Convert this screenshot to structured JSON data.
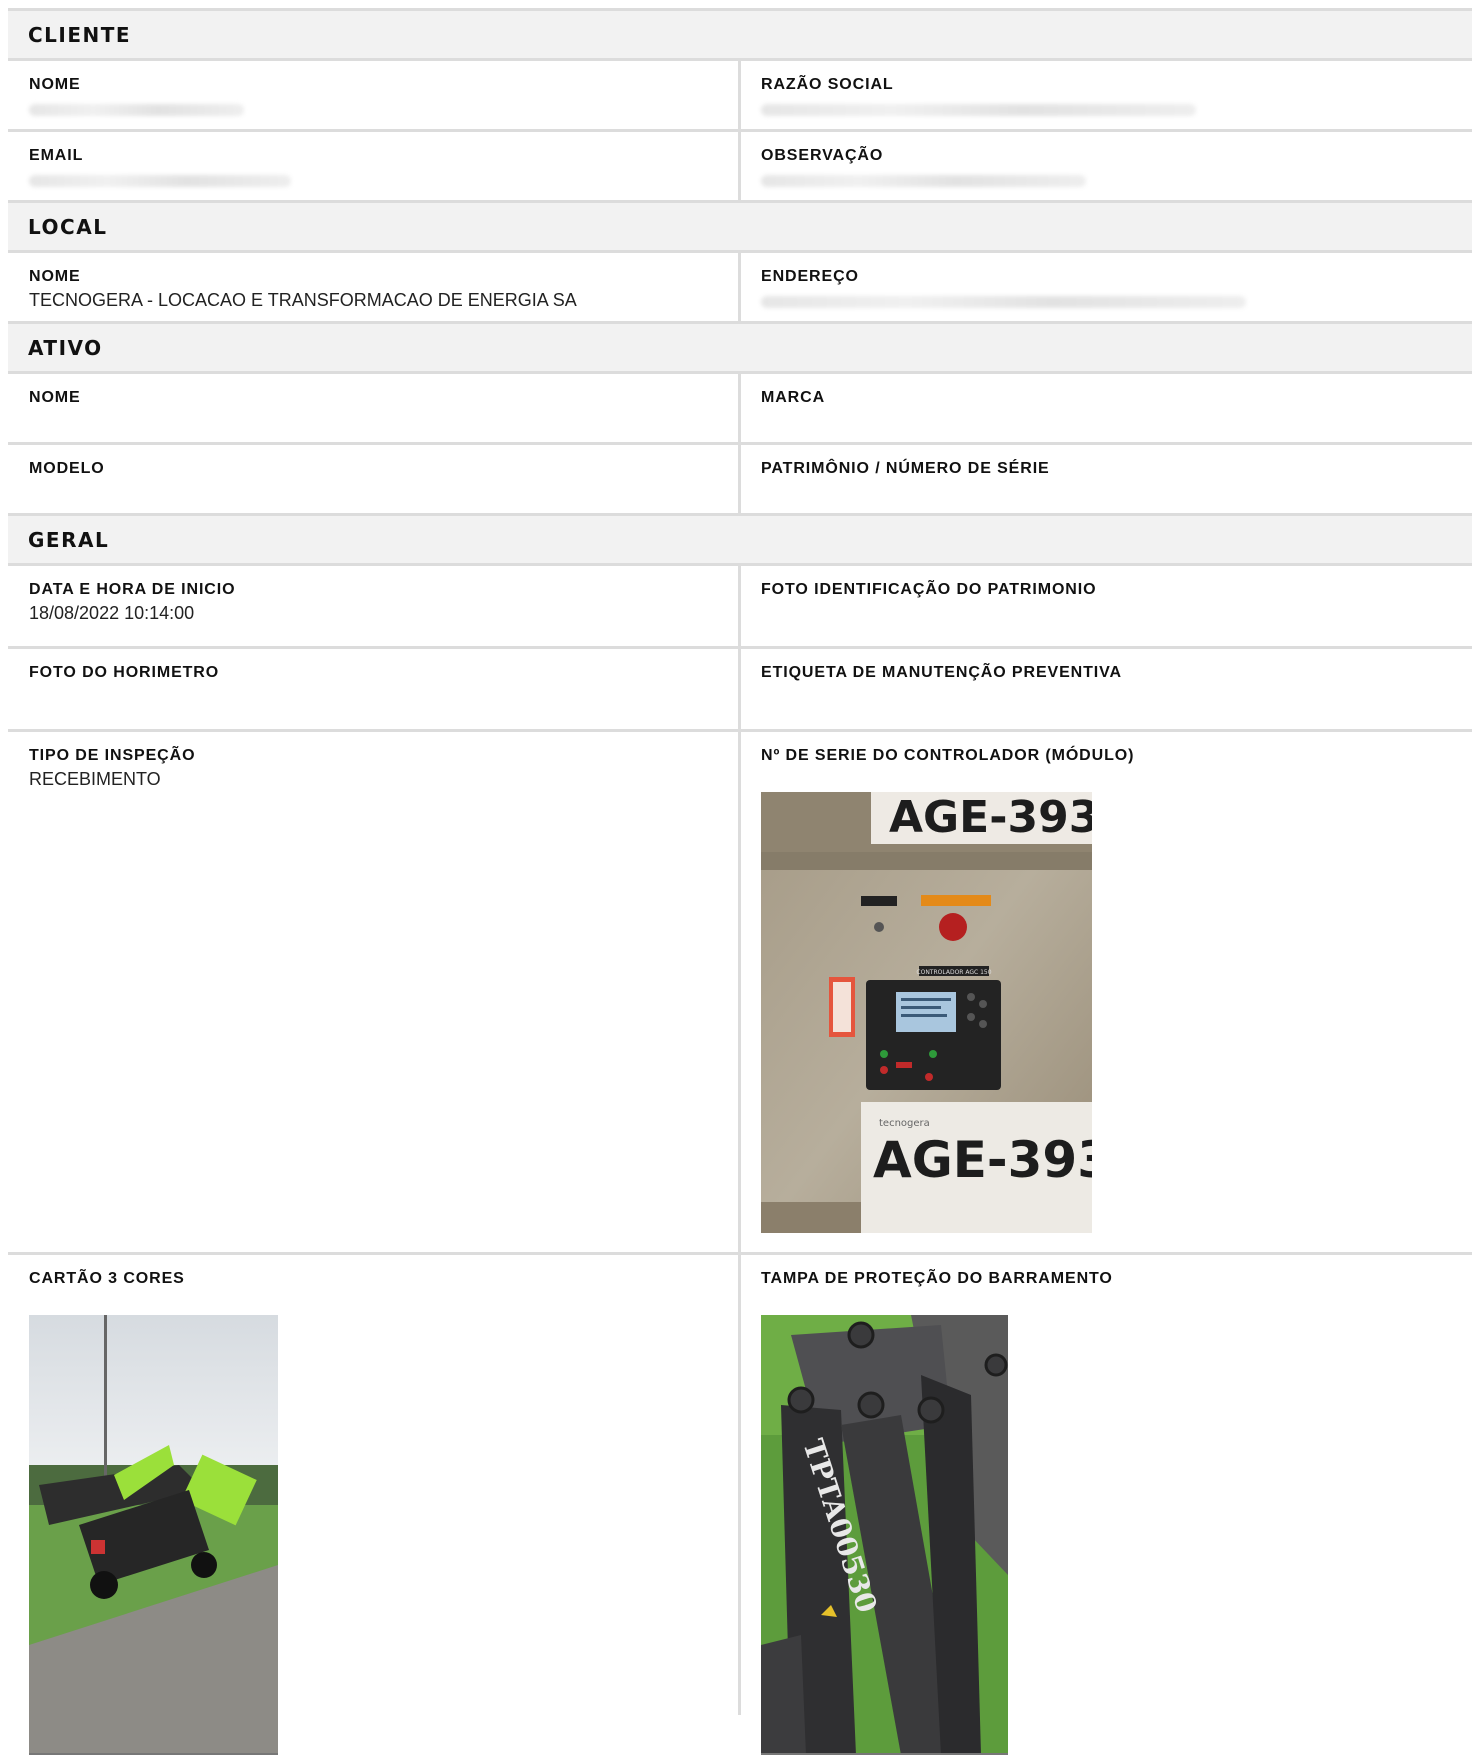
{
  "cliente": {
    "title": "CLIENTE",
    "nome_label": "NOME",
    "razao_label": "RAZÃO SOCIAL",
    "email_label": "EMAIL",
    "obs_label": "OBSERVAÇÃO"
  },
  "local": {
    "title": "LOCAL",
    "nome_label": "NOME",
    "nome_value": "TECNOGERA - LOCACAO E TRANSFORMACAO DE ENERGIA SA",
    "endereco_label": "ENDEREÇO"
  },
  "ativo": {
    "title": "ATIVO",
    "nome_label": "NOME",
    "marca_label": "MARCA",
    "modelo_label": "MODELO",
    "patrimonio_label": "PATRIMÔNIO / NÚMERO DE SÉRIE"
  },
  "geral": {
    "title": "GERAL",
    "data_label": "DATA E HORA DE INICIO",
    "data_value": "18/08/2022 10:14:00",
    "foto_ident_label": "FOTO IDENTIFICAÇÃO DO PATRIMONIO",
    "foto_horimetro_label": "FOTO DO HORIMETRO",
    "etiqueta_label": "ETIQUETA DE MANUTENÇÃO PREVENTIVA",
    "tipo_label": "TIPO DE INSPEÇÃO",
    "tipo_value": "RECEBIMENTO",
    "serie_label": "Nº DE SERIE DO CONTROLADOR (MÓDULO)",
    "cartao_label": "CARTÃO 3 CORES",
    "tampa_label": "TAMPA DE PROTEÇÃO DO BARRAMENTO"
  },
  "photos": {
    "controller_plate_top": "AGE-393",
    "controller_plate_bottom": "AGE-393",
    "controller_brand": "tecnogera",
    "controller_tag": "CONTROLADOR AGC 150",
    "busbar_serial": "TPTA00530"
  }
}
